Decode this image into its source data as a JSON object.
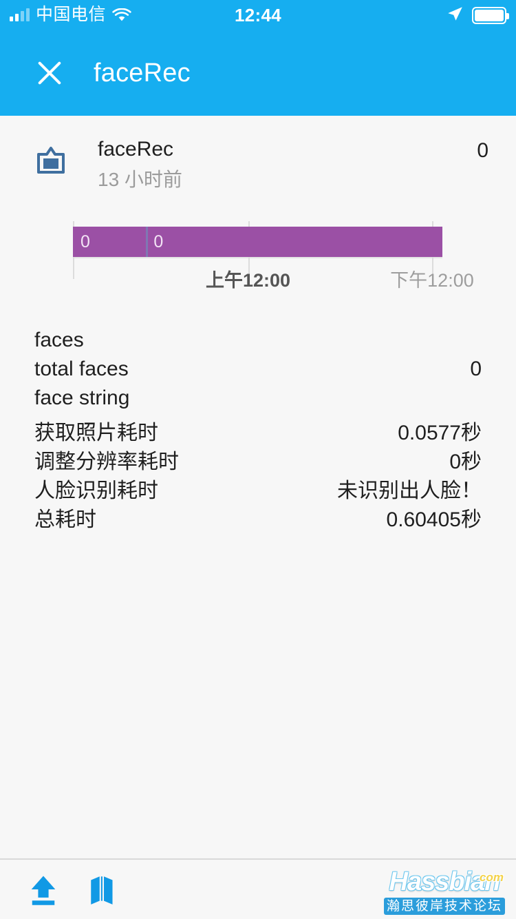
{
  "status_bar": {
    "carrier": "中国电信",
    "time": "12:44",
    "signal_icon": "signal-bars-icon",
    "wifi_icon": "wifi-icon",
    "location_icon": "location-arrow-icon",
    "battery_icon": "battery-full-icon"
  },
  "app_bar": {
    "close_icon": "close-icon",
    "title": "faceRec",
    "background": "#16aef0"
  },
  "card": {
    "icon": "picture-frame-icon",
    "name": "faceRec",
    "time_ago": "13 小时前",
    "value": "0"
  },
  "chart_data": {
    "type": "bar",
    "title": "",
    "xlabel": "",
    "ylabel": "",
    "orientation": "horizontal-timeline",
    "bar_color": "#9b50a5",
    "grid": true,
    "segments": [
      {
        "label": "0",
        "start_pct": 0,
        "end_pct": 19.8
      },
      {
        "label": "0",
        "start_pct": 19.8,
        "end_pct": 100
      }
    ],
    "axis_ticks": [
      {
        "label": "上午12:00",
        "position_pct": 47.4,
        "emphasis": "primary"
      },
      {
        "label": "下午12:00",
        "position_pct": 97.2,
        "emphasis": "secondary"
      }
    ],
    "gridline_positions_pct": [
      0,
      47.4,
      97.2
    ],
    "values": [
      0,
      0
    ],
    "categories": [
      "0",
      "0"
    ]
  },
  "details": [
    {
      "key": "faces",
      "value": ""
    },
    {
      "key": "total faces",
      "value": "0"
    },
    {
      "key": "face string",
      "value": ""
    },
    {
      "key": "获取照片耗时",
      "value": "0.0577秒"
    },
    {
      "key": "调整分辨率耗时",
      "value": "0秒"
    },
    {
      "key": "人脸识别耗时",
      "value": "未识别出人脸！"
    },
    {
      "key": "总耗时",
      "value": "0.60405秒"
    }
  ],
  "toolbar": {
    "upload_icon": "upload-icon",
    "map_icon": "map-icon",
    "icon_color": "#1199e5"
  },
  "watermark": {
    "brand": "Hassbian",
    "tld": "com",
    "subtitle": "瀚思彼岸技术论坛"
  }
}
